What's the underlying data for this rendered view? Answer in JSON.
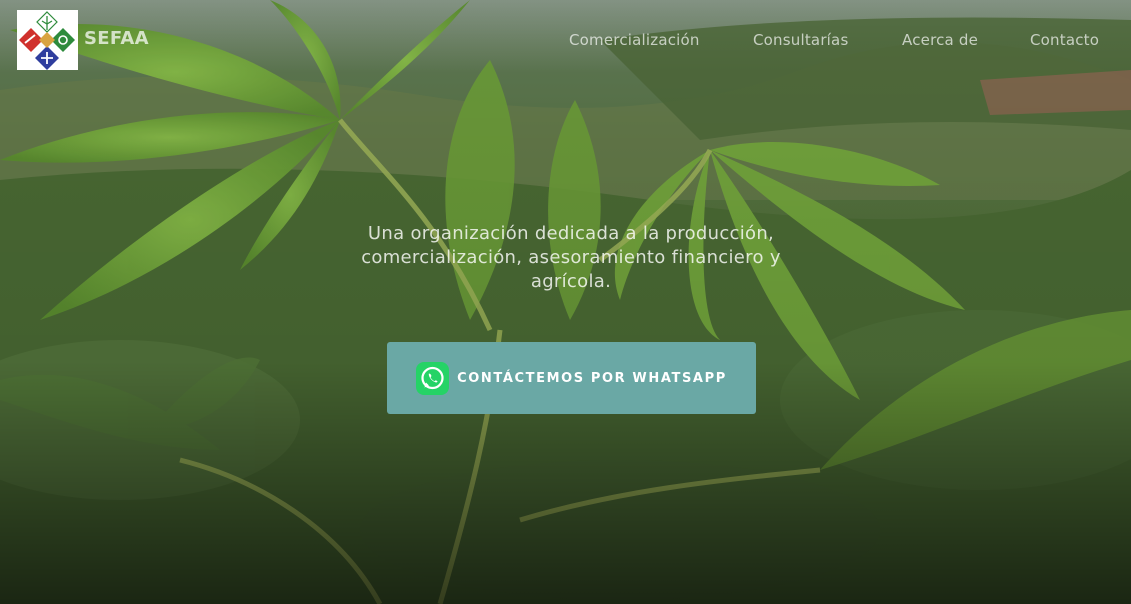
{
  "site": {
    "brand": "SEFAA",
    "logo_icon": "sefaa-logo-icon"
  },
  "nav": {
    "items": [
      {
        "label": "Comercialización"
      },
      {
        "label": "Consultarías"
      },
      {
        "label": "Acerca de"
      },
      {
        "label": "Contacto"
      }
    ]
  },
  "hero": {
    "tagline_line1": "Una organización dedicada a la producción,",
    "tagline_line2": "comercialización, asesoramiento financiero y",
    "tagline_line3": "agrícola.",
    "background": "cassava-plants-field-photo",
    "cta": {
      "label": "CONTÁCTEMOS POR WHATSAPP",
      "icon": "whatsapp-icon",
      "color": "#6aa8a5"
    }
  },
  "colors": {
    "whatsapp_green": "#25d366",
    "leaf_green": "#7fb441",
    "logo_red": "#d0312d",
    "logo_blue": "#2f3e9e",
    "logo_green": "#2e8b3c"
  }
}
